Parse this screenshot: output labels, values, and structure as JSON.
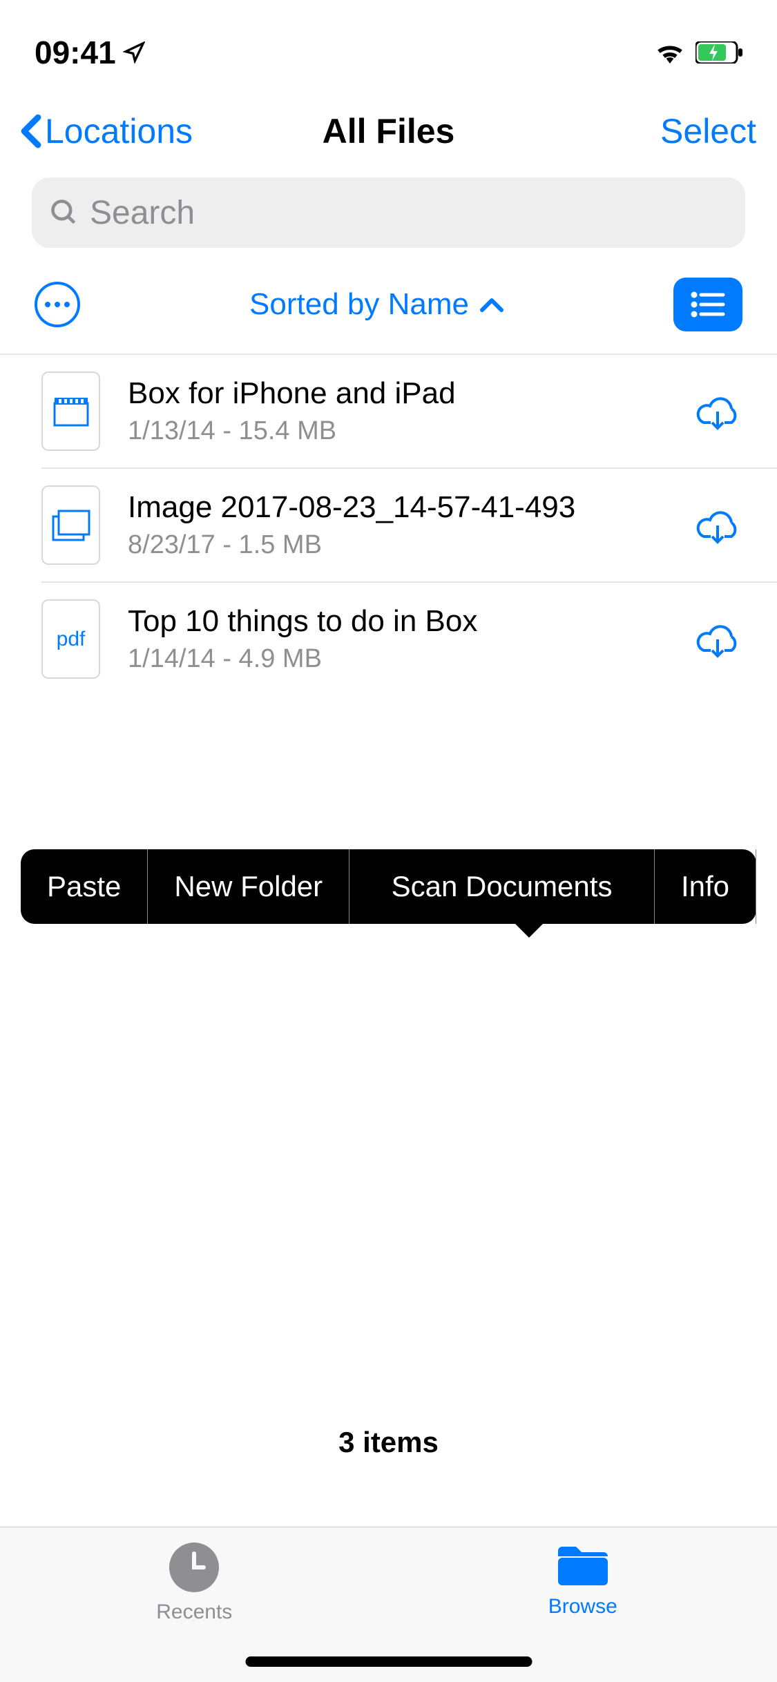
{
  "status": {
    "time": "09:41"
  },
  "nav": {
    "back_label": "Locations",
    "title": "All Files",
    "select_label": "Select"
  },
  "search": {
    "placeholder": "Search"
  },
  "toolbar": {
    "sort_label": "Sorted by Name"
  },
  "files": [
    {
      "name": "Box for iPhone and iPad",
      "meta": "1/13/14 - 15.4 MB",
      "icon": "video"
    },
    {
      "name": "Image 2017-08-23_14-57-41-493",
      "meta": "8/23/17 - 1.5 MB",
      "icon": "image"
    },
    {
      "name": "Top 10 things to do in Box",
      "meta": "1/14/14 - 4.9 MB",
      "icon": "pdf"
    }
  ],
  "context_menu": {
    "items": [
      "Paste",
      "New Folder",
      "Scan Documents",
      "Info"
    ]
  },
  "footer": {
    "count_label": "3 items"
  },
  "tabs": {
    "recents": "Recents",
    "browse": "Browse"
  }
}
